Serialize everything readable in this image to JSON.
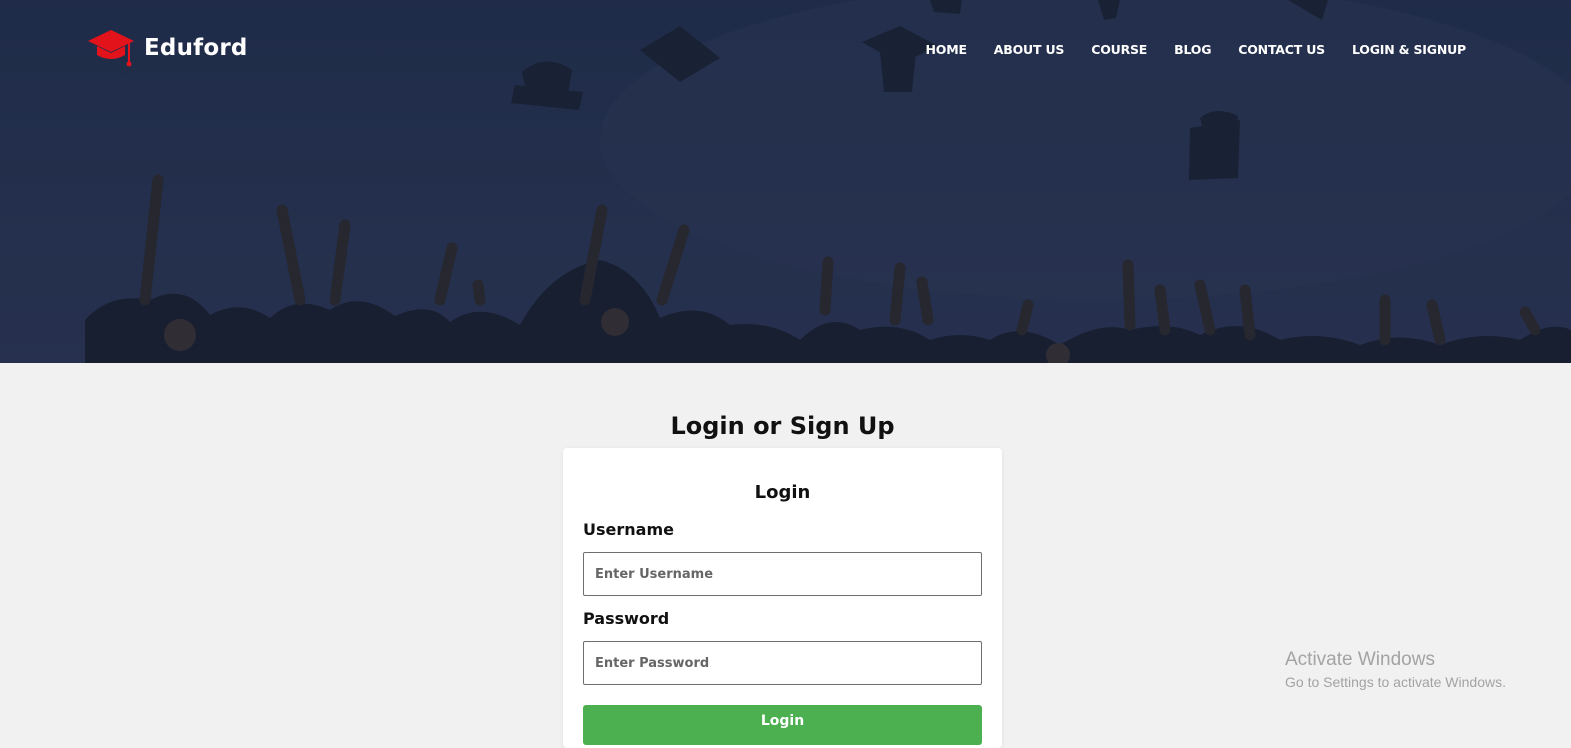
{
  "brand": {
    "name": "Eduford",
    "logo_icon": "graduation-cap-icon",
    "logo_color": "#e3131b"
  },
  "nav": {
    "items": [
      {
        "label": "HOME"
      },
      {
        "label": "ABOUT US"
      },
      {
        "label": "COURSE"
      },
      {
        "label": "BLOG"
      },
      {
        "label": "CONTACT US"
      },
      {
        "label": "LOGIN & SIGNUP"
      }
    ]
  },
  "hero": {
    "overlay_color": "#1f2c49"
  },
  "login_section": {
    "title": "Login or Sign Up",
    "card": {
      "title": "Login",
      "username_label": "Username",
      "username_placeholder": "Enter Username",
      "username_value": "",
      "password_label": "Password",
      "password_placeholder": "Enter Password",
      "password_value": "",
      "submit_label": "Login",
      "submit_color": "#4caf50"
    }
  },
  "watermark": {
    "title": "Activate Windows",
    "subtitle": "Go to Settings to activate Windows."
  }
}
